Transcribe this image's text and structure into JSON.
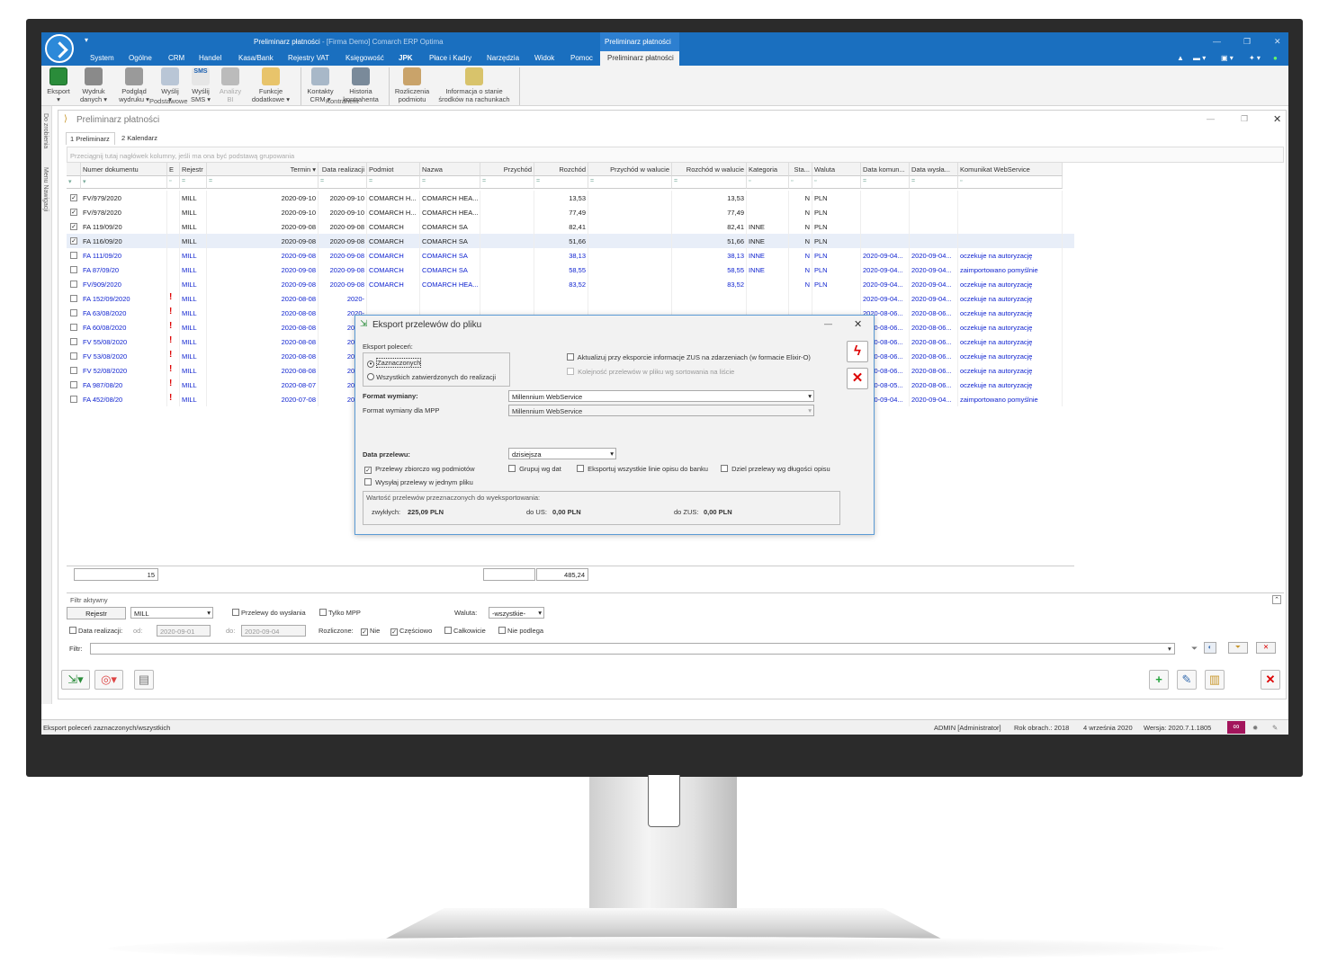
{
  "app": {
    "title": "Preliminarz płatności",
    "title_suffix": "- [Firma Demo] Comarch ERP Optima",
    "context_tab": "Preliminarz płatności"
  },
  "menu": [
    "System",
    "Ogólne",
    "CRM",
    "Handel",
    "Kasa/Bank",
    "Rejestry VAT",
    "Księgowość",
    "JPK",
    "Płace i Kadry",
    "Narzędzia",
    "Widok",
    "Pomoc",
    "Preliminarz płatności"
  ],
  "ribbon": {
    "buttons": [
      {
        "label1": "Eksport",
        "label2": "▾",
        "icon": "excel-export-icon"
      },
      {
        "label1": "Wydruk",
        "label2": "danych ▾",
        "icon": "printer-icon"
      },
      {
        "label1": "Podgląd",
        "label2": "wydruku ▾",
        "icon": "print-preview-icon"
      },
      {
        "label1": "Wyślij",
        "label2": "▾",
        "icon": "send-icon"
      },
      {
        "label1": "Wyślij",
        "label2": "SMS ▾",
        "icon": "sms-icon",
        "badge": "SMS"
      },
      {
        "label1": "Analizy",
        "label2": "BI",
        "icon": "bi-analysis-icon"
      },
      {
        "label1": "Funkcje",
        "label2": "dodatkowe ▾",
        "icon": "gears-icon"
      },
      {
        "label1": "Kontakty",
        "label2": "CRM ▾",
        "icon": "crm-contacts-icon"
      },
      {
        "label1": "Historia",
        "label2": "kontrahenta",
        "icon": "contractor-history-icon"
      },
      {
        "label1": "Rozliczenia",
        "label2": "podmiotu",
        "icon": "settlements-icon"
      },
      {
        "label1": "Informacja o stanie",
        "label2": "środków na rachunkach",
        "icon": "account-balance-icon"
      }
    ],
    "groups": [
      "Podstawowe",
      "Kontrahent"
    ]
  },
  "left_strip": [
    "Do zrobienia",
    "Menu Nawigacji"
  ],
  "window": {
    "title": "Preliminarz płatności",
    "tabs": [
      "1 Preliminarz",
      "2 Kalendarz"
    ],
    "group_hint": "Przeciągnij tutaj nagłówek kolumny, jeśli ma ona być podstawą grupowania"
  },
  "grid": {
    "columns": [
      "Numer dokumentu",
      "E",
      "Rejestr",
      "Termin ▾",
      "Data realizacji",
      "Podmiot",
      "Nazwa",
      "Przychód",
      "Rozchód",
      "Przychód w walucie",
      "Rozchód w walucie",
      "Kategoria",
      "Sta...",
      "Waluta",
      "Data komun...",
      "Data wysła...",
      "Komunikat WebService"
    ],
    "filter_glyphs": [
      "▾",
      "▫",
      "=",
      "=",
      "=",
      "=",
      "=",
      "=",
      "=",
      "=",
      "=",
      "▫",
      "▫",
      "▫",
      "=",
      "=",
      "▫"
    ],
    "rows": [
      {
        "checked": true,
        "blue": false,
        "doc": "FV/979/2020",
        "e": "",
        "reg": "MILL",
        "termin": "2020-09-10",
        "real": "2020-09-10",
        "podmiot": "COMARCH H...",
        "nazwa": "COMARCH HEA...",
        "przychod": "",
        "rozchod": "13,53",
        "przwal": "",
        "rozwal": "13,53",
        "kat": "",
        "sta": "N",
        "wal": "PLN",
        "dk": "",
        "dw": "",
        "kom": ""
      },
      {
        "checked": true,
        "blue": false,
        "doc": "FV/978/2020",
        "e": "",
        "reg": "MILL",
        "termin": "2020-09-10",
        "real": "2020-09-10",
        "podmiot": "COMARCH H...",
        "nazwa": "COMARCH HEA...",
        "przychod": "",
        "rozchod": "77,49",
        "przwal": "",
        "rozwal": "77,49",
        "kat": "",
        "sta": "N",
        "wal": "PLN",
        "dk": "",
        "dw": "",
        "kom": ""
      },
      {
        "checked": true,
        "blue": false,
        "doc": "FA 119/09/20",
        "e": "",
        "reg": "MILL",
        "termin": "2020-09-08",
        "real": "2020-09-08",
        "podmiot": "COMARCH",
        "nazwa": "COMARCH SA",
        "przychod": "",
        "rozchod": "82,41",
        "przwal": "",
        "rozwal": "82,41",
        "kat": "INNE",
        "sta": "N",
        "wal": "PLN",
        "dk": "",
        "dw": "",
        "kom": ""
      },
      {
        "checked": true,
        "blue": false,
        "sel": true,
        "doc": "FA 116/09/20",
        "e": "",
        "reg": "MILL",
        "termin": "2020-09-08",
        "real": "2020-09-08",
        "podmiot": "COMARCH",
        "nazwa": "COMARCH SA",
        "przychod": "",
        "rozchod": "51,66",
        "przwal": "",
        "rozwal": "51,66",
        "kat": "INNE",
        "sta": "N",
        "wal": "PLN",
        "dk": "",
        "dw": "",
        "kom": ""
      },
      {
        "checked": false,
        "blue": true,
        "doc": "FA 111/09/20",
        "e": "",
        "reg": "MILL",
        "termin": "2020-09-08",
        "real": "2020-09-08",
        "podmiot": "COMARCH",
        "nazwa": "COMARCH SA",
        "przychod": "",
        "rozchod": "38,13",
        "przwal": "",
        "rozwal": "38,13",
        "kat": "INNE",
        "sta": "N",
        "wal": "PLN",
        "dk": "2020-09-04...",
        "dw": "2020-09-04...",
        "kom": "oczekuje na autoryzację"
      },
      {
        "checked": false,
        "blue": true,
        "doc": "FA 87/09/20",
        "e": "",
        "reg": "MILL",
        "termin": "2020-09-08",
        "real": "2020-09-08",
        "podmiot": "COMARCH",
        "nazwa": "COMARCH SA",
        "przychod": "",
        "rozchod": "58,55",
        "przwal": "",
        "rozwal": "58,55",
        "kat": "INNE",
        "sta": "N",
        "wal": "PLN",
        "dk": "2020-09-04...",
        "dw": "2020-09-04...",
        "kom": "zaimportowano pomyślnie"
      },
      {
        "checked": false,
        "blue": true,
        "doc": "FV/909/2020",
        "e": "",
        "reg": "MILL",
        "termin": "2020-09-08",
        "real": "2020-09-08",
        "podmiot": "COMARCH",
        "nazwa": "COMARCH HEA...",
        "przychod": "",
        "rozchod": "83,52",
        "przwal": "",
        "rozwal": "83,52",
        "kat": "",
        "sta": "N",
        "wal": "PLN",
        "dk": "2020-09-04...",
        "dw": "2020-09-04...",
        "kom": "oczekuje na autoryzację"
      },
      {
        "checked": false,
        "blue": true,
        "doc": "FA 152/09/2020",
        "e": "!",
        "reg": "MILL",
        "termin": "2020-08-08",
        "real": "2020-",
        "podmiot": "",
        "nazwa": "",
        "przychod": "",
        "rozchod": "",
        "przwal": "",
        "rozwal": "",
        "kat": "",
        "sta": "",
        "wal": "",
        "dk": "2020-09-04...",
        "dw": "2020-09-04...",
        "kom": "oczekuje na autoryzację"
      },
      {
        "checked": false,
        "blue": true,
        "doc": "FA 63/08/2020",
        "e": "!",
        "reg": "MILL",
        "termin": "2020-08-08",
        "real": "2020-",
        "podmiot": "",
        "nazwa": "",
        "przychod": "",
        "rozchod": "",
        "przwal": "",
        "rozwal": "",
        "kat": "",
        "sta": "",
        "wal": "",
        "dk": "2020-08-06...",
        "dw": "2020-08-06...",
        "kom": "oczekuje na autoryzację"
      },
      {
        "checked": false,
        "blue": true,
        "doc": "FA 60/08/2020",
        "e": "!",
        "reg": "MILL",
        "termin": "2020-08-08",
        "real": "2020-",
        "podmiot": "",
        "nazwa": "",
        "przychod": "",
        "rozchod": "",
        "przwal": "",
        "rozwal": "",
        "kat": "",
        "sta": "",
        "wal": "",
        "dk": "2020-08-06...",
        "dw": "2020-08-06...",
        "kom": "oczekuje na autoryzację"
      },
      {
        "checked": false,
        "blue": true,
        "doc": "FV 55/08/2020",
        "e": "!",
        "reg": "MILL",
        "termin": "2020-08-08",
        "real": "2020-",
        "podmiot": "",
        "nazwa": "",
        "przychod": "",
        "rozchod": "",
        "przwal": "",
        "rozwal": "",
        "kat": "",
        "sta": "",
        "wal": "",
        "dk": "2020-08-06...",
        "dw": "2020-08-06...",
        "kom": "oczekuje na autoryzację"
      },
      {
        "checked": false,
        "blue": true,
        "doc": "FV 53/08/2020",
        "e": "!",
        "reg": "MILL",
        "termin": "2020-08-08",
        "real": "2020-",
        "podmiot": "",
        "nazwa": "",
        "przychod": "",
        "rozchod": "",
        "przwal": "",
        "rozwal": "",
        "kat": "",
        "sta": "",
        "wal": "",
        "dk": "2020-08-06...",
        "dw": "2020-08-06...",
        "kom": "oczekuje na autoryzację"
      },
      {
        "checked": false,
        "blue": true,
        "doc": "FV 52/08/2020",
        "e": "!",
        "reg": "MILL",
        "termin": "2020-08-08",
        "real": "2020-",
        "podmiot": "",
        "nazwa": "",
        "przychod": "",
        "rozchod": "",
        "przwal": "",
        "rozwal": "",
        "kat": "",
        "sta": "",
        "wal": "",
        "dk": "2020-08-06...",
        "dw": "2020-08-06...",
        "kom": "oczekuje na autoryzację"
      },
      {
        "checked": false,
        "blue": true,
        "doc": "FA 987/08/20",
        "e": "!",
        "reg": "MILL",
        "termin": "2020-08-07",
        "real": "2020-",
        "podmiot": "",
        "nazwa": "",
        "przychod": "",
        "rozchod": "",
        "przwal": "",
        "rozwal": "",
        "kat": "",
        "sta": "",
        "wal": "",
        "dk": "2020-08-05...",
        "dw": "2020-08-06...",
        "kom": "oczekuje na autoryzację"
      },
      {
        "checked": false,
        "blue": true,
        "doc": "FA 452/08/20",
        "e": "!",
        "reg": "MILL",
        "termin": "2020-07-08",
        "real": "2020-",
        "podmiot": "",
        "nazwa": "",
        "przychod": "",
        "rozchod": "",
        "przwal": "",
        "rozwal": "",
        "kat": "",
        "sta": "",
        "wal": "",
        "dk": "2020-09-04...",
        "dw": "2020-09-04...",
        "kom": "zaimportowano pomyślnie"
      }
    ],
    "summary": {
      "count": "15",
      "rozchod": "485,24"
    }
  },
  "filter": {
    "title": "Filtr aktywny",
    "rejestr_btn": "Rejestr",
    "rejestr_value": "MILL",
    "przelewy_do_wyslania": "Przelewy do wysłania",
    "tylko_mpp": "Tylko MPP",
    "waluta_label": "Waluta:",
    "waluta_value": "-wszystkie-",
    "data_realizacji": "Data realizacji:",
    "od": "od:",
    "od_value": "2020-09-01",
    "do": "do:",
    "do_value": "2020-09-04",
    "rozliczone": "Rozliczone:",
    "nie": "Nie",
    "czesciowo": "Częściowo",
    "calkowicie": "Całkowicie",
    "nie_podlega": "Nie podlega",
    "filtr_label": "Filtr:",
    "filtr_value": ""
  },
  "status": {
    "message": "Eksport poleceń zaznaczonych/wszystkich",
    "user": "ADMIN [Administrator]",
    "year": "Rok obrach.: 2018",
    "date": "4 września 2020",
    "version": "Wersja: 2020.7.1.1805",
    "infinity": "∞"
  },
  "dialog": {
    "title": "Eksport przelewów do pliku",
    "export_group": "Eksport poleceń:",
    "opt_selected": "Zaznaczonych",
    "opt_all": "Wszystkich zatwierdzonych do realizacji",
    "zus_update": "Aktualizuj przy eksporcie informacje ZUS na zdarzeniach (w formacie Elixir-O)",
    "order": "Kolejność przelewów w pliku wg sortowania na liście",
    "format_label": "Format wymiany:",
    "format_value": "Millennium WebService",
    "format_mpp_label": "Format wymiany dla MPP",
    "format_mpp_value": "Millennium WebService",
    "date_label": "Data przelewu:",
    "date_value": "dzisiejsza",
    "zbiorczo": "Przelewy zbiorczo wg podmiotów",
    "grupuj": "Grupuj wg dat",
    "eksportuj_linie": "Eksportuj wszystkie linie opisu do banku",
    "dziel": "Dziel przelewy wg długości opisu",
    "jeden_plik": "Wysyłaj przelewy w jednym pliku",
    "value_title": "Wartość przelewów przeznaczonych do wyeksportowania:",
    "zwyklych_label": "zwykłych:",
    "zwyklych_value": "225,09 PLN",
    "us_label": "do US:",
    "us_value": "0,00 PLN",
    "zus_label": "do ZUS:",
    "zus_value": "0,00 PLN"
  }
}
